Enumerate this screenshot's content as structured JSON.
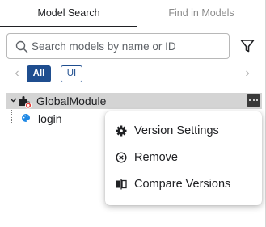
{
  "tabs": [
    {
      "label": "Model Search",
      "active": true
    },
    {
      "label": "Find in Models",
      "active": false
    }
  ],
  "search": {
    "placeholder": "Search models by name or ID",
    "value": ""
  },
  "filter": {
    "icon": "filter-icon"
  },
  "chips": [
    {
      "label": "All",
      "selected": true
    },
    {
      "label": "UI",
      "selected": false
    }
  ],
  "tree": {
    "module": {
      "label": "GlobalModule",
      "icon": "module-puzzle-icon",
      "badge": "red-status-badge"
    },
    "children": [
      {
        "label": "login",
        "icon": "palette-icon"
      }
    ]
  },
  "context_menu": {
    "items": [
      {
        "label": "Version Settings",
        "icon": "gear-icon"
      },
      {
        "label": "Remove",
        "icon": "remove-circle-icon"
      },
      {
        "label": "Compare Versions",
        "icon": "compare-icon"
      }
    ]
  },
  "colors": {
    "accent": "#1f4e8f",
    "selection": "#d4d4d4",
    "badge": "#e53935",
    "child_icon": "#1e88e5"
  }
}
